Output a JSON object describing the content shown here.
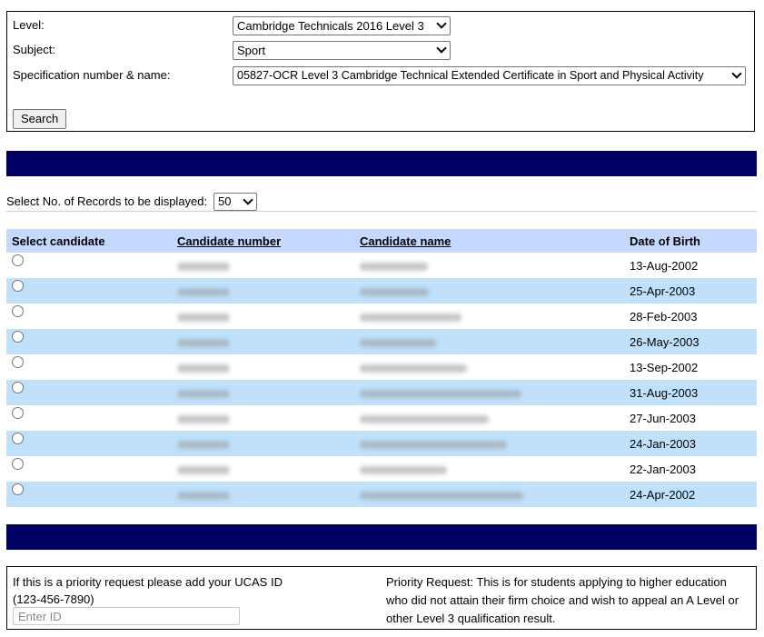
{
  "search": {
    "level_label": "Level:",
    "level_value": "Cambridge Technicals 2016 Level 3",
    "subject_label": "Subject:",
    "subject_value": "Sport",
    "spec_label": "Specification number & name:",
    "spec_value": "05827-OCR Level 3 Cambridge Technical Extended Certificate in Sport and Physical Activity",
    "search_button": "Search"
  },
  "records": {
    "label": "Select No. of Records to be displayed:",
    "value": "50"
  },
  "table": {
    "headers": [
      "Select candidate",
      "Candidate number",
      "Candidate name",
      "Date of Birth"
    ],
    "rows": [
      {
        "dob": "13-Aug-2002"
      },
      {
        "dob": "25-Apr-2003"
      },
      {
        "dob": "28-Feb-2003"
      },
      {
        "dob": "26-May-2003"
      },
      {
        "dob": "13-Sep-2002"
      },
      {
        "dob": "31-Aug-2003"
      },
      {
        "dob": "27-Jun-2003"
      },
      {
        "dob": "24-Jan-2003"
      },
      {
        "dob": "22-Jan-2003"
      },
      {
        "dob": "24-Apr-2002"
      }
    ]
  },
  "priority": {
    "left_text_1": "If this is a priority request please add your UCAS ID",
    "left_text_2": "(123-456-7890)",
    "ucas_placeholder": "Enter ID",
    "right_text": "Priority Request: This is for students applying to higher education who did not attain their firm choice and wish to appeal an A Level or other Level 3 qualification result."
  },
  "colors": {
    "banner": "#000066",
    "header_row": "#c5d9ff",
    "alt_row": "#bfe1fb"
  }
}
